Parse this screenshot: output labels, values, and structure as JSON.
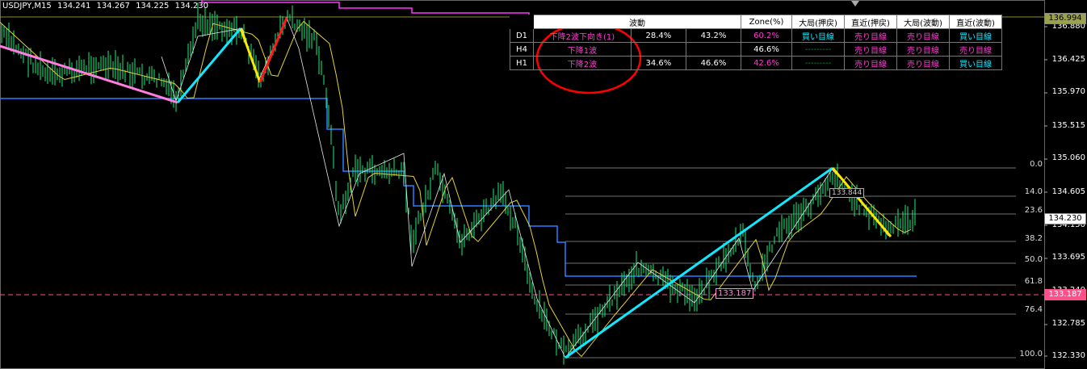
{
  "header": {
    "symbol": "USDJPY,M15",
    "open": "134.241",
    "high": "134.267",
    "low": "134.225",
    "close": "134.230"
  },
  "price_axis": {
    "ticks": [
      "136.880",
      "136.425",
      "135.970",
      "135.515",
      "135.060",
      "134.605",
      "134.150",
      "133.695",
      "133.240",
      "132.785",
      "132.330"
    ],
    "top_tag": "136.994",
    "current_tag": "134.230",
    "line_tag": "133.187"
  },
  "fibonacci": {
    "levels": [
      "0.0",
      "14.0",
      "23.6",
      "38.2",
      "50.0",
      "61.8",
      "76.4",
      "100.0"
    ]
  },
  "annotations": {
    "low_tag": "133.187",
    "box_tag": "133.844"
  },
  "table": {
    "headers": [
      "波動",
      "Zone(%)",
      "大局(押戻)",
      "直近(押戻)",
      "大局(波動)",
      "直近(波動)"
    ],
    "rows": [
      {
        "tf": "D1",
        "wave": "下降2波下向き(1)",
        "z1": "28.4%",
        "z2": "43.2%",
        "z3": "60.2%",
        "c1": "買い目線",
        "c2": "売り目線",
        "c3": "売り目線",
        "c4": "買い目線"
      },
      {
        "tf": "H4",
        "wave": "下降1波",
        "z1": "",
        "z2": "",
        "z3": "46.6%",
        "c1": "---------",
        "c2": "売り目線",
        "c3": "売り目線",
        "c4": "売り目線"
      },
      {
        "tf": "H1",
        "wave": "下降2波",
        "z1": "34.6%",
        "z2": "46.6%",
        "z3": "42.6%",
        "c1": "---------",
        "c2": "売り目線",
        "c3": "売り目線",
        "c4": "買い目線"
      }
    ]
  },
  "colors": {
    "candle": "#19f07e",
    "zigzag_cyan": "#10e8ff",
    "zigzag_yellow": "#ffe600",
    "zigzag_red": "#ff1a1a",
    "zigzag_pink": "#ff7ee0",
    "blue_line": "#2a7fff",
    "ma_line": "#e6d23a",
    "magenta": "#ff33ff",
    "circle": "#ff0000"
  }
}
